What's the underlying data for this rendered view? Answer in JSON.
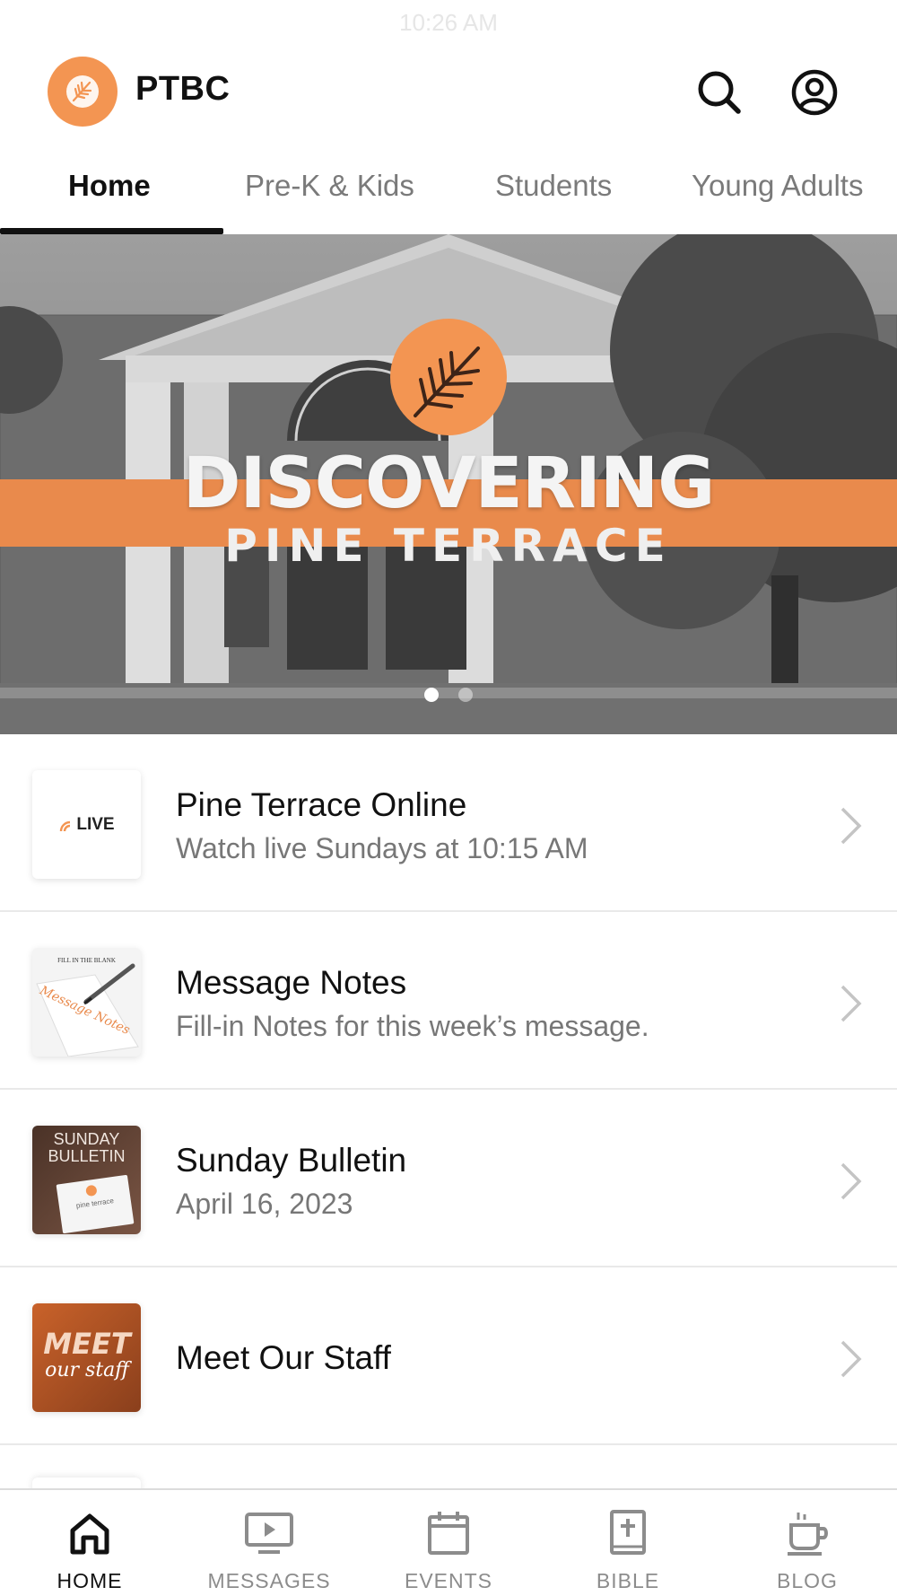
{
  "status_bar": {
    "time": "10:26 AM"
  },
  "header": {
    "app_name": "PTBC",
    "logo_icon": "pine-leaf-logo",
    "search_icon": "search-icon",
    "profile_icon": "user-circle-icon"
  },
  "tabs": [
    {
      "label": "Home",
      "active": true
    },
    {
      "label": "Pre-K & Kids",
      "active": false
    },
    {
      "label": "Students",
      "active": false
    },
    {
      "label": "Young Adults",
      "active": false
    }
  ],
  "hero": {
    "title": "DISCOVERING",
    "subtitle": "PINE TERRACE",
    "slide_count": 2,
    "active_slide": 1
  },
  "list_items": [
    {
      "title": "Pine Terrace Online",
      "subtitle": "Watch live Sundays at 10:15 AM",
      "thumb_label": "LIVE"
    },
    {
      "title": "Message Notes",
      "subtitle": "Fill-in Notes for this week’s message.",
      "thumb_label": "FILL IN THE BLANK",
      "thumb_script": "Message Notes"
    },
    {
      "title": "Sunday Bulletin",
      "subtitle": "April 16, 2023",
      "thumb_label": "SUNDAY BULLETIN",
      "thumb_line2": "pine terrace"
    },
    {
      "title": "Meet Our Staff",
      "subtitle": "",
      "thumb_label": "MEET",
      "thumb_script": "our staff"
    }
  ],
  "tab_bar": [
    {
      "label": "HOME",
      "icon": "home-icon",
      "active": true
    },
    {
      "label": "MESSAGES",
      "icon": "tv-play-icon",
      "active": false
    },
    {
      "label": "EVENTS",
      "icon": "calendar-icon",
      "active": false
    },
    {
      "label": "BIBLE",
      "icon": "bible-icon",
      "active": false
    },
    {
      "label": "BLOG",
      "icon": "coffee-cup-icon",
      "active": false
    }
  ],
  "colors": {
    "accent_orange": "#f39552",
    "band_orange": "#e98a4c",
    "text_primary": "#111111",
    "text_secondary": "#777777",
    "tab_inactive": "#8c8c8c"
  }
}
